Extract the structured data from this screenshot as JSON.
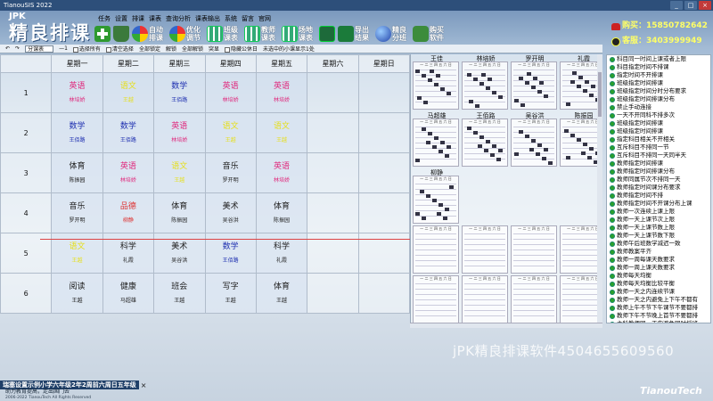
{
  "window": {
    "title": "TianouSIS 2022"
  },
  "brand": {
    "small": "JPK",
    "big": "精良排课"
  },
  "menu": [
    "任务",
    "设置",
    "排课",
    "课表",
    "查询分析",
    "课表输出",
    "系统",
    "留言",
    "官网"
  ],
  "toolbar": [
    {
      "label": "",
      "icon": "add-icon"
    },
    {
      "label": "",
      "icon": "plant-icon"
    },
    {
      "label": "自动排课",
      "icon": "auto-schedule-icon"
    },
    {
      "label": "优化调节",
      "icon": "optimize-icon"
    },
    {
      "label": "班级课表",
      "icon": "class-table-icon"
    },
    {
      "label": "教师课表",
      "icon": "teacher-table-icon"
    },
    {
      "label": "场地课表",
      "icon": "venue-table-icon"
    },
    {
      "label": "",
      "icon": "save-icon"
    },
    {
      "label": "导出结果",
      "icon": "export-icon"
    },
    {
      "label": "精良分班",
      "icon": "class-split-icon"
    },
    {
      "label": "购买软件",
      "icon": "buy-icon"
    }
  ],
  "contact": {
    "buy": "购买：15850782642",
    "service": "客服：3403999949"
  },
  "subbar": {
    "dropdown": "分课表",
    "num": "—1",
    "options": [
      "选择所有",
      "清空选择"
    ],
    "actions": [
      "全部锁定",
      "解锁",
      "全部解锁",
      "突显"
    ],
    "hint": "隐藏公休日",
    "hint2": "未选中的小课显示1处"
  },
  "schedule": {
    "days": [
      "星期一",
      "星期二",
      "星期三",
      "星期四",
      "星期五",
      "星期六",
      "星期日"
    ],
    "rows": [
      {
        "period": "1",
        "cells": [
          {
            "s": "英语",
            "t": "林培娇",
            "c": "pink"
          },
          {
            "s": "语文",
            "t": "王越",
            "c": "yel"
          },
          {
            "s": "数学",
            "t": "王佰路",
            "c": "blue"
          },
          {
            "s": "英语",
            "t": "林培娇",
            "c": "pink"
          },
          {
            "s": "英语",
            "t": "林培娇",
            "c": "pink"
          },
          {
            "s": "",
            "t": "",
            "c": ""
          },
          {
            "s": "",
            "t": "",
            "c": ""
          }
        ]
      },
      {
        "period": "2",
        "cells": [
          {
            "s": "数学",
            "t": "王佰路",
            "c": "blue"
          },
          {
            "s": "数学",
            "t": "王佰路",
            "c": "blue"
          },
          {
            "s": "英语",
            "t": "林培娇",
            "c": "pink"
          },
          {
            "s": "语文",
            "t": "王越",
            "c": "yel"
          },
          {
            "s": "语文",
            "t": "王越",
            "c": "yel"
          },
          {
            "s": "",
            "t": "",
            "c": ""
          },
          {
            "s": "",
            "t": "",
            "c": ""
          }
        ]
      },
      {
        "period": "3",
        "cells": [
          {
            "s": "体育",
            "t": "陈振园",
            "c": "blk"
          },
          {
            "s": "英语",
            "t": "林培娇",
            "c": "pink"
          },
          {
            "s": "语文",
            "t": "王越",
            "c": "yel"
          },
          {
            "s": "音乐",
            "t": "罗开明",
            "c": "blk"
          },
          {
            "s": "英语",
            "t": "林培娇",
            "c": "pink"
          },
          {
            "s": "",
            "t": "",
            "c": ""
          },
          {
            "s": "",
            "t": "",
            "c": ""
          }
        ]
      },
      {
        "period": "4",
        "cells": [
          {
            "s": "音乐",
            "t": "罗开明",
            "c": "blk"
          },
          {
            "s": "品德",
            "t": "柳静",
            "c": "red"
          },
          {
            "s": "体育",
            "t": "陈振园",
            "c": "blk"
          },
          {
            "s": "美术",
            "t": "吴谷洪",
            "c": "blk"
          },
          {
            "s": "体育",
            "t": "陈振园",
            "c": "blk"
          },
          {
            "s": "",
            "t": "",
            "c": ""
          },
          {
            "s": "",
            "t": "",
            "c": ""
          }
        ]
      },
      {
        "period": "5",
        "cells": [
          {
            "s": "语文",
            "t": "王越",
            "c": "yel"
          },
          {
            "s": "科学",
            "t": "礼霞",
            "c": "blk"
          },
          {
            "s": "美术",
            "t": "吴谷洪",
            "c": "blk"
          },
          {
            "s": "数学",
            "t": "王佰路",
            "c": "blue"
          },
          {
            "s": "科学",
            "t": "礼霞",
            "c": "blk"
          },
          {
            "s": "",
            "t": "",
            "c": ""
          },
          {
            "s": "",
            "t": "",
            "c": ""
          }
        ]
      },
      {
        "period": "6",
        "cells": [
          {
            "s": "阅读",
            "t": "王越",
            "c": "blk"
          },
          {
            "s": "健康",
            "t": "马超雄",
            "c": "blk"
          },
          {
            "s": "班会",
            "t": "王越",
            "c": "blk"
          },
          {
            "s": "写字",
            "t": "王越",
            "c": "blk"
          },
          {
            "s": "体育",
            "t": "王越",
            "c": "blk"
          },
          {
            "s": "",
            "t": "",
            "c": ""
          },
          {
            "s": "",
            "t": "",
            "c": ""
          }
        ]
      }
    ]
  },
  "teachers": {
    "names": [
      "王佳",
      "林培娇",
      "罗开明",
      "礼霞",
      "马超雄",
      "王佰路",
      "吴谷洪",
      "陈振园",
      "柳静"
    ],
    "dayheader": "一 二 三 四 五 六 日"
  },
  "rules": [
    "科目同一时间上课或者上限",
    "科目指定时间不排课",
    "指定时间不开排课",
    "班级指定时间排课",
    "班级指定时间分时分布要求",
    "班级指定时间排课分布",
    "禁止手动连接",
    "一天不开同科不排多次",
    "班级指定时间排课",
    "班级指定时间排课",
    "指定科目相关不开相关",
    "互斥科目不排同一节",
    "互斥科目不排同一天同半天",
    "教师指定时间排课",
    "教师指定时间排课分布",
    "教师同属节次不排同一天",
    "教师指定时间课分布要求",
    "教师指定时间不排",
    "教师指定时间不开课分布上课",
    "教师一次连续上课上限",
    "教师一天上课节次上限",
    "教师一天上课节数上限",
    "教师一天上课节数下限",
    "教师午后班数学减迟一致",
    "教师教案平齐",
    "教师一周每课天数要求",
    "教师一周上课天数要求",
    "教师每天均衡",
    "教师每天均衡比较平衡",
    "教师一天之内连续节课",
    "教师一天之内避免上下午不都有",
    "教师上午不节下午课节不要都排",
    "教师下午不节晚上首节不要都排",
    "主科教师同一天内避免同时授班",
    "教师同一天教师避免连续授课",
    "教师每一天班级内避免异体课",
    "教师同一天之内避免调度上限",
    "教师周末周四不排课",
    "场地指定时间不排课",
    "场地同一时间占用上限",
    "互斥教师避免同时上课"
  ],
  "watermark": "jPK精良排课软件4504655609560",
  "brandtag": "TianouTech",
  "doc": {
    "tab": "瑞塞设置示例小学六年级2年2周前六周日五年级",
    "close": "×"
  },
  "footer": {
    "line1": "助力教育提高，走出国门去",
    "line2": "2006-2022 TianouTech All Rights Reserved"
  }
}
